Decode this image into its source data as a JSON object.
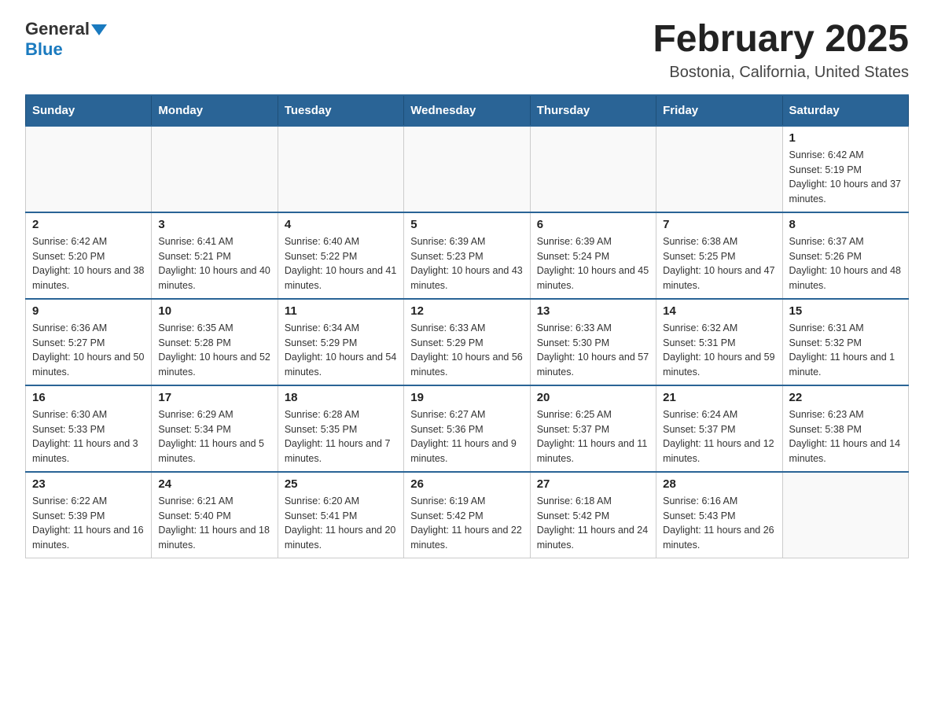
{
  "header": {
    "logo_general": "General",
    "logo_blue": "Blue",
    "month_title": "February 2025",
    "location": "Bostonia, California, United States"
  },
  "days_of_week": [
    "Sunday",
    "Monday",
    "Tuesday",
    "Wednesday",
    "Thursday",
    "Friday",
    "Saturday"
  ],
  "weeks": [
    [
      {
        "day": "",
        "info": ""
      },
      {
        "day": "",
        "info": ""
      },
      {
        "day": "",
        "info": ""
      },
      {
        "day": "",
        "info": ""
      },
      {
        "day": "",
        "info": ""
      },
      {
        "day": "",
        "info": ""
      },
      {
        "day": "1",
        "info": "Sunrise: 6:42 AM\nSunset: 5:19 PM\nDaylight: 10 hours and 37 minutes."
      }
    ],
    [
      {
        "day": "2",
        "info": "Sunrise: 6:42 AM\nSunset: 5:20 PM\nDaylight: 10 hours and 38 minutes."
      },
      {
        "day": "3",
        "info": "Sunrise: 6:41 AM\nSunset: 5:21 PM\nDaylight: 10 hours and 40 minutes."
      },
      {
        "day": "4",
        "info": "Sunrise: 6:40 AM\nSunset: 5:22 PM\nDaylight: 10 hours and 41 minutes."
      },
      {
        "day": "5",
        "info": "Sunrise: 6:39 AM\nSunset: 5:23 PM\nDaylight: 10 hours and 43 minutes."
      },
      {
        "day": "6",
        "info": "Sunrise: 6:39 AM\nSunset: 5:24 PM\nDaylight: 10 hours and 45 minutes."
      },
      {
        "day": "7",
        "info": "Sunrise: 6:38 AM\nSunset: 5:25 PM\nDaylight: 10 hours and 47 minutes."
      },
      {
        "day": "8",
        "info": "Sunrise: 6:37 AM\nSunset: 5:26 PM\nDaylight: 10 hours and 48 minutes."
      }
    ],
    [
      {
        "day": "9",
        "info": "Sunrise: 6:36 AM\nSunset: 5:27 PM\nDaylight: 10 hours and 50 minutes."
      },
      {
        "day": "10",
        "info": "Sunrise: 6:35 AM\nSunset: 5:28 PM\nDaylight: 10 hours and 52 minutes."
      },
      {
        "day": "11",
        "info": "Sunrise: 6:34 AM\nSunset: 5:29 PM\nDaylight: 10 hours and 54 minutes."
      },
      {
        "day": "12",
        "info": "Sunrise: 6:33 AM\nSunset: 5:29 PM\nDaylight: 10 hours and 56 minutes."
      },
      {
        "day": "13",
        "info": "Sunrise: 6:33 AM\nSunset: 5:30 PM\nDaylight: 10 hours and 57 minutes."
      },
      {
        "day": "14",
        "info": "Sunrise: 6:32 AM\nSunset: 5:31 PM\nDaylight: 10 hours and 59 minutes."
      },
      {
        "day": "15",
        "info": "Sunrise: 6:31 AM\nSunset: 5:32 PM\nDaylight: 11 hours and 1 minute."
      }
    ],
    [
      {
        "day": "16",
        "info": "Sunrise: 6:30 AM\nSunset: 5:33 PM\nDaylight: 11 hours and 3 minutes."
      },
      {
        "day": "17",
        "info": "Sunrise: 6:29 AM\nSunset: 5:34 PM\nDaylight: 11 hours and 5 minutes."
      },
      {
        "day": "18",
        "info": "Sunrise: 6:28 AM\nSunset: 5:35 PM\nDaylight: 11 hours and 7 minutes."
      },
      {
        "day": "19",
        "info": "Sunrise: 6:27 AM\nSunset: 5:36 PM\nDaylight: 11 hours and 9 minutes."
      },
      {
        "day": "20",
        "info": "Sunrise: 6:25 AM\nSunset: 5:37 PM\nDaylight: 11 hours and 11 minutes."
      },
      {
        "day": "21",
        "info": "Sunrise: 6:24 AM\nSunset: 5:37 PM\nDaylight: 11 hours and 12 minutes."
      },
      {
        "day": "22",
        "info": "Sunrise: 6:23 AM\nSunset: 5:38 PM\nDaylight: 11 hours and 14 minutes."
      }
    ],
    [
      {
        "day": "23",
        "info": "Sunrise: 6:22 AM\nSunset: 5:39 PM\nDaylight: 11 hours and 16 minutes."
      },
      {
        "day": "24",
        "info": "Sunrise: 6:21 AM\nSunset: 5:40 PM\nDaylight: 11 hours and 18 minutes."
      },
      {
        "day": "25",
        "info": "Sunrise: 6:20 AM\nSunset: 5:41 PM\nDaylight: 11 hours and 20 minutes."
      },
      {
        "day": "26",
        "info": "Sunrise: 6:19 AM\nSunset: 5:42 PM\nDaylight: 11 hours and 22 minutes."
      },
      {
        "day": "27",
        "info": "Sunrise: 6:18 AM\nSunset: 5:42 PM\nDaylight: 11 hours and 24 minutes."
      },
      {
        "day": "28",
        "info": "Sunrise: 6:16 AM\nSunset: 5:43 PM\nDaylight: 11 hours and 26 minutes."
      },
      {
        "day": "",
        "info": ""
      }
    ]
  ]
}
